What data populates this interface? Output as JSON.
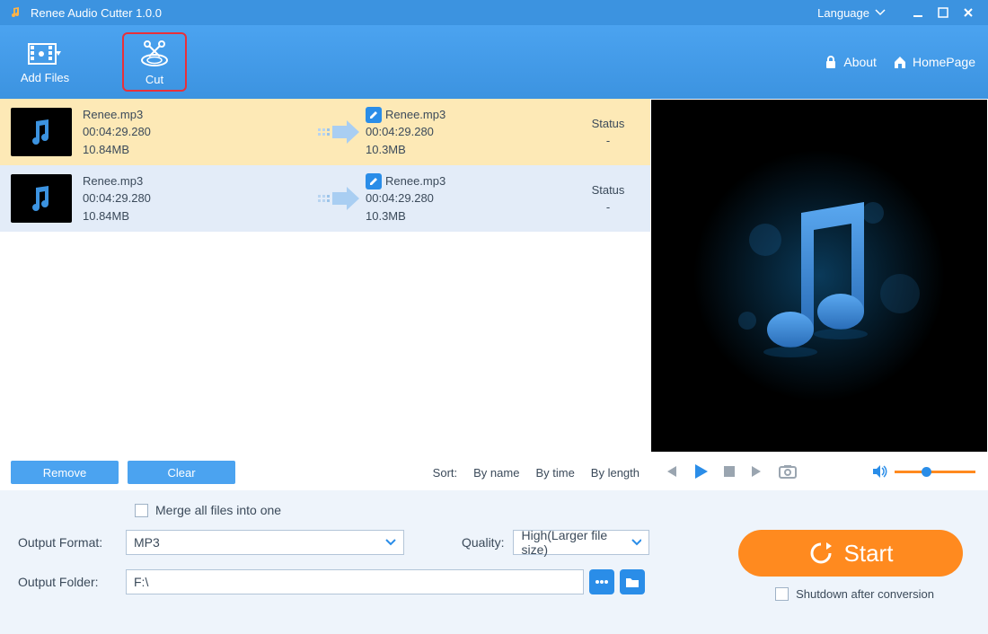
{
  "titlebar": {
    "title": "Renee Audio Cutter 1.0.0",
    "language_label": "Language"
  },
  "toolbar": {
    "add_files": "Add Files",
    "cut": "Cut",
    "about": "About",
    "homepage": "HomePage"
  },
  "files": [
    {
      "name": "Renee.mp3",
      "duration": "00:04:29.280",
      "size": "10.84MB",
      "out_name": "Renee.mp3",
      "out_duration": "00:04:29.280",
      "out_size": "10.3MB",
      "status_label": "Status",
      "status_value": "-"
    },
    {
      "name": "Renee.mp3",
      "duration": "00:04:29.280",
      "size": "10.84MB",
      "out_name": "Renee.mp3",
      "out_duration": "00:04:29.280",
      "out_size": "10.3MB",
      "status_label": "Status",
      "status_value": "-"
    }
  ],
  "list_footer": {
    "remove": "Remove",
    "clear": "Clear",
    "sort_label": "Sort:",
    "by_name": "By name",
    "by_time": "By time",
    "by_length": "By length"
  },
  "bottom": {
    "merge": "Merge all files into one",
    "output_format_label": "Output Format:",
    "output_format_value": "MP3",
    "quality_label": "Quality:",
    "quality_value": "High(Larger file size)",
    "output_folder_label": "Output Folder:",
    "output_folder_value": "F:\\",
    "start": "Start",
    "shutdown": "Shutdown after conversion"
  }
}
